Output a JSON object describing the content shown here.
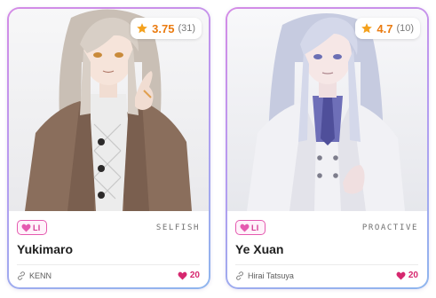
{
  "cards": [
    {
      "rating": {
        "score": "3.75",
        "count": "(31)"
      },
      "badge": "LI",
      "trait": "SELFISH",
      "name": "Yukimaro",
      "creator": "KENN",
      "likes": "20"
    },
    {
      "rating": {
        "score": "4.7",
        "count": "(10)"
      },
      "badge": "LI",
      "trait": "PROACTIVE",
      "name": "Ye Xuan",
      "creator": "Hirai Tatsuya",
      "likes": "20"
    }
  ],
  "colors": {
    "accent_pink": "#e55ab0",
    "rating_orange": "#ea7b10",
    "like_pink": "#d6286f",
    "border_gradient": [
      "#d48be6",
      "#8fb6ee"
    ]
  },
  "icons": {
    "rating": "star-icon",
    "badge": "heart-icon",
    "creator": "link-icon",
    "likes": "heart-icon"
  }
}
